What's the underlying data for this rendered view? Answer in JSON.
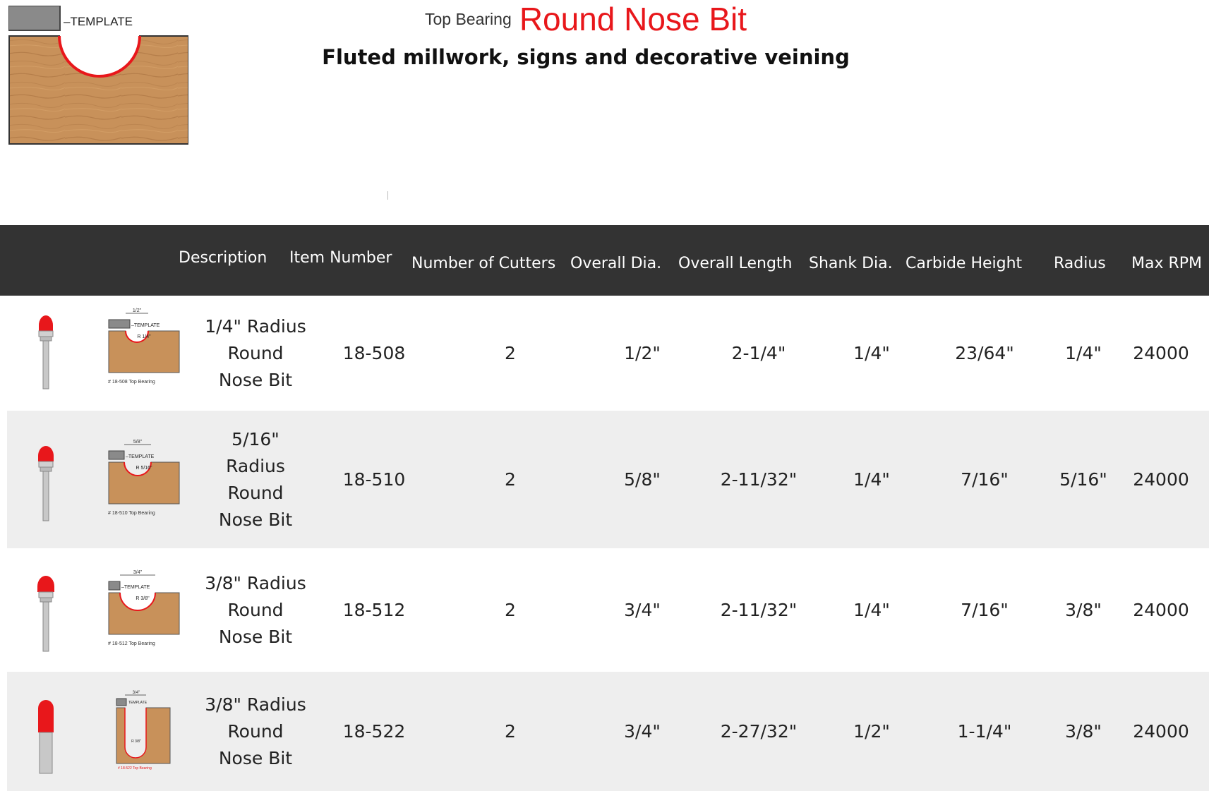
{
  "hero": {
    "template_label": "–TEMPLATE"
  },
  "header": {
    "subtitle_small": "Top Bearing",
    "title": "Round Nose Bit",
    "tagline": "Fluted millwork, signs and decorative veining"
  },
  "table": {
    "headers": [
      "Description",
      "Item Number",
      "Number of Cutters",
      "Overall Dia.",
      "Overall Length",
      "Shank Dia.",
      "Carbide Height",
      "Radius",
      "Max RPM"
    ],
    "rows": [
      {
        "description": [
          "1/4\" Radius",
          "Round",
          "Nose Bit"
        ],
        "item_number": "18-508",
        "cutters": "2",
        "overall_dia": "1/2\"",
        "overall_length": "2-1/4\"",
        "shank_dia": "1/4\"",
        "carbide_height": "23/64\"",
        "radius": "1/4\"",
        "max_rpm": "24000",
        "diagram": {
          "dim": "1/2\"",
          "template": "–TEMPLATE",
          "radius": "R 1/4\"",
          "caption": "# 18-508 Top Bearing"
        }
      },
      {
        "description": [
          "5/16\"",
          "Radius",
          "Round",
          "Nose Bit"
        ],
        "item_number": "18-510",
        "cutters": "2",
        "overall_dia": "5/8\"",
        "overall_length": "2-11/32\"",
        "shank_dia": "1/4\"",
        "carbide_height": "7/16\"",
        "radius": "5/16\"",
        "max_rpm": "24000",
        "diagram": {
          "dim": "5/8\"",
          "template": "–TEMPLATE",
          "radius": "R 5/16\"",
          "caption": "# 18-510 Top Bearing"
        }
      },
      {
        "description": [
          "3/8\" Radius",
          "Round",
          "Nose Bit"
        ],
        "item_number": "18-512",
        "cutters": "2",
        "overall_dia": "3/4\"",
        "overall_length": "2-11/32\"",
        "shank_dia": "1/4\"",
        "carbide_height": "7/16\"",
        "radius": "3/8\"",
        "max_rpm": "24000",
        "diagram": {
          "dim": "3/4\"",
          "template": "–TEMPLATE",
          "radius": "R 3/8\"",
          "caption": "# 18-512 Top Bearing"
        }
      },
      {
        "description": [
          "3/8\" Radius",
          "Round",
          "Nose Bit"
        ],
        "item_number": "18-522",
        "cutters": "2",
        "overall_dia": "3/4\"",
        "overall_length": "2-27/32\"",
        "shank_dia": "1/2\"",
        "carbide_height": "1-1/4\"",
        "radius": "3/8\"",
        "max_rpm": "24000",
        "diagram": {
          "dim": "3/4\"",
          "template": "TEMPLATE",
          "radius": "R 3/8\"",
          "caption": "# 18-522 Top Bearing"
        }
      }
    ]
  },
  "colors": {
    "accent_red": "#e8171b",
    "header_bg": "#333333",
    "row_alt": "#eeeeee",
    "wood": "#c8915a"
  }
}
